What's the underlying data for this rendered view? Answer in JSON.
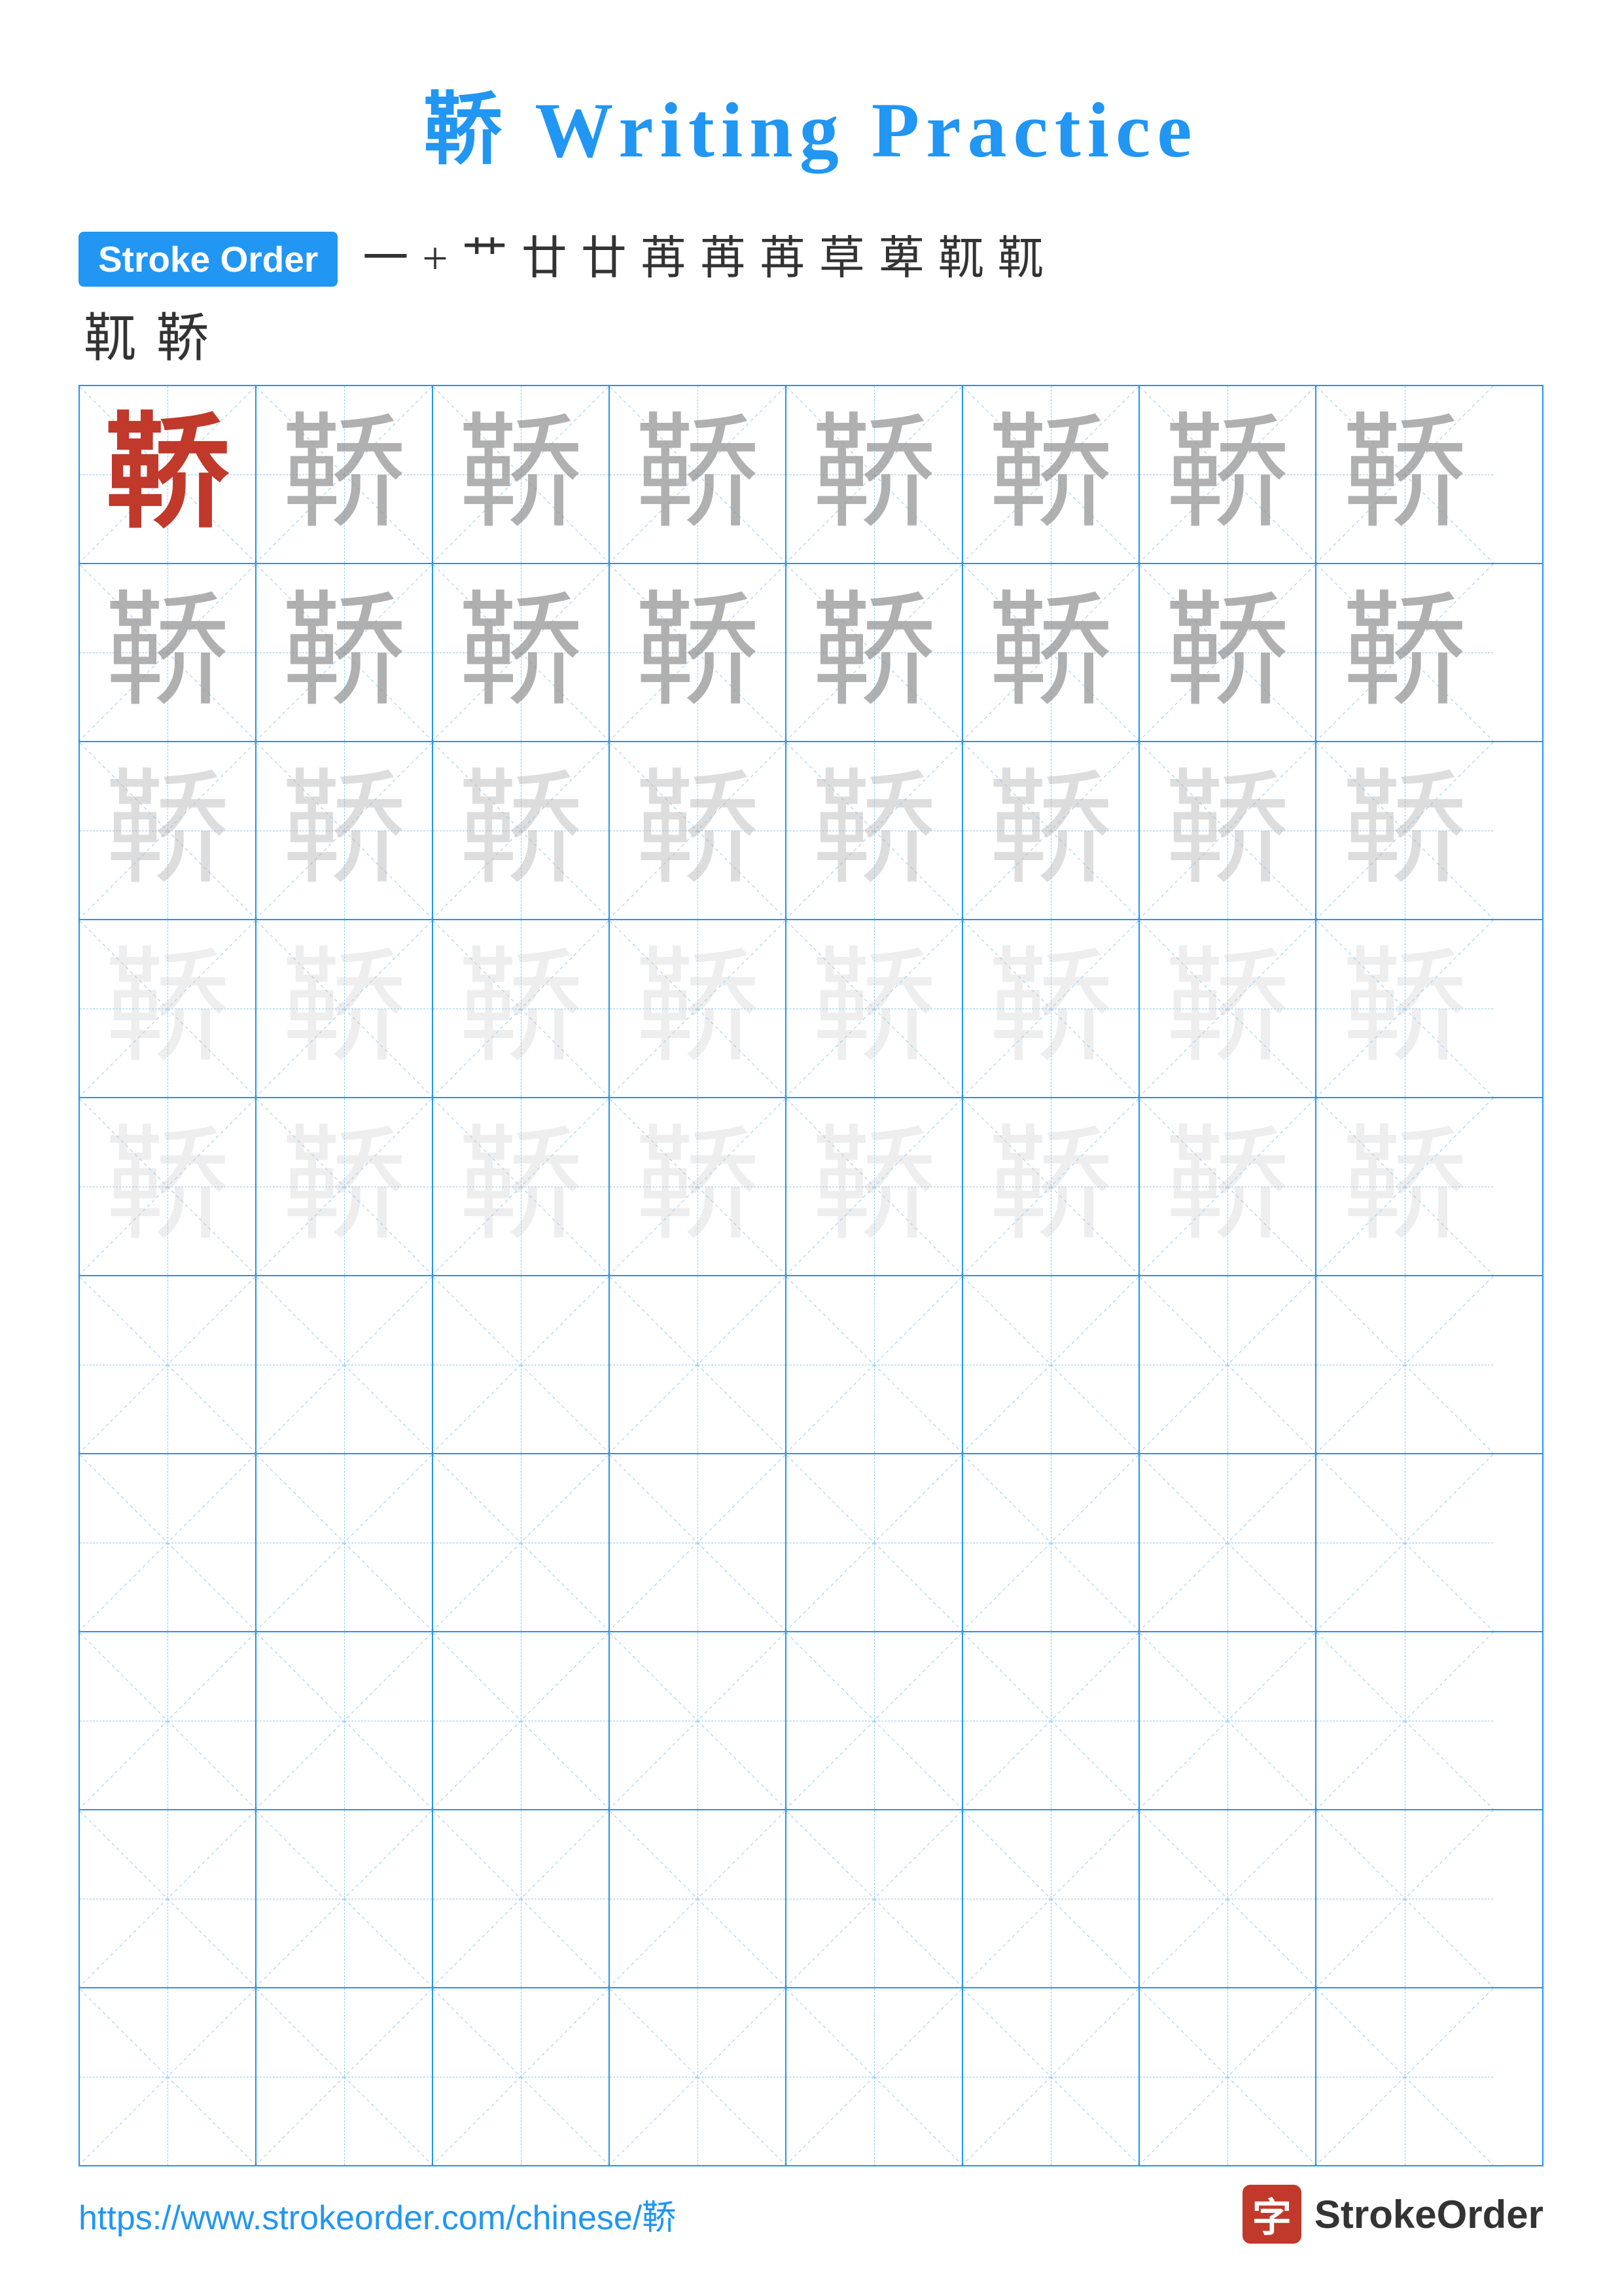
{
  "title": {
    "char": "鞒",
    "suffix": " Writing Practice",
    "full": "鞒 Writing Practice"
  },
  "stroke_order": {
    "badge_label": "Stroke Order",
    "sequence": [
      "一",
      "+",
      "艹",
      "廿",
      "廿",
      "苒",
      "苒",
      "苒",
      "草",
      "萆",
      "靰",
      "靰"
    ],
    "sequence_below": [
      "靰",
      "鞒"
    ]
  },
  "grid": {
    "rows": 10,
    "cols": 8,
    "char": "鞒",
    "practice_rows": [
      "dark",
      "medium",
      "light",
      "faint",
      "faint",
      "empty",
      "empty",
      "empty",
      "empty",
      "empty"
    ]
  },
  "footer": {
    "url": "https://www.strokeorder.com/chinese/鞒",
    "logo_char": "字",
    "logo_text": "StrokeOrder"
  }
}
